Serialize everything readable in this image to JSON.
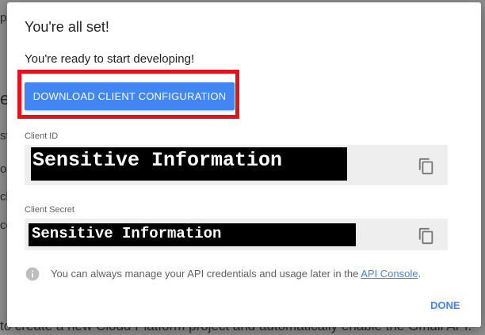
{
  "background": {
    "left_fragments": [
      "p",
      "e",
      "st",
      "o",
      "ck",
      "co"
    ],
    "bottom_line": "to create a new Cloud Platform project and automatically enable the Gmail API."
  },
  "dialog": {
    "title": "You're all set!",
    "subtitle": "You're ready to start developing!",
    "download_button_label": "DOWNLOAD CLIENT CONFIGURATION",
    "client_id": {
      "label": "Client ID",
      "value": "Sensitive Information"
    },
    "client_secret": {
      "label": "Client Secret",
      "value": "Sensitive Information"
    },
    "info": {
      "text": "You can always manage your API credentials and usage later in the ",
      "link_text": "API Console",
      "suffix": "."
    },
    "done_label": "DONE"
  },
  "colors": {
    "accent": "#4285f4",
    "highlight": "#e3131e",
    "field_bg": "#eeeeee",
    "overlay": "#8f8f8f"
  },
  "icons": {
    "copy": "copy-icon",
    "info": "info-icon"
  }
}
